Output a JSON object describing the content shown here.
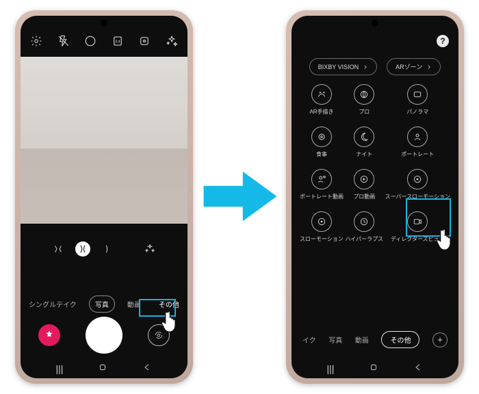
{
  "left": {
    "top_icons": [
      "settings",
      "flash-off",
      "motion-off",
      "aspect-ratio",
      "motion-photo",
      "filters"
    ],
    "modes": {
      "single_take": "シングルテイク",
      "photo": "写真",
      "video": "動画",
      "more": "その他"
    }
  },
  "arrow_color": "#14b9e8",
  "right": {
    "pills": {
      "bixby": "BIXBY VISION",
      "arzone": "ARゾーン"
    },
    "grid": [
      {
        "id": "ar-doodle",
        "label": "AR手描き"
      },
      {
        "id": "pro",
        "label": "プロ"
      },
      {
        "id": "panorama",
        "label": "パノラマ"
      },
      {
        "id": "food",
        "label": "食事"
      },
      {
        "id": "night",
        "label": "ナイト"
      },
      {
        "id": "portrait",
        "label": "ポートレート"
      },
      {
        "id": "portrait-video",
        "label": "ポートレート動画"
      },
      {
        "id": "pro-video",
        "label": "プロ動画"
      },
      {
        "id": "super-slomo",
        "label": "スーパースローモーション"
      },
      {
        "id": "slomo",
        "label": "スローモーション"
      },
      {
        "id": "hyperlapse",
        "label": "ハイパーラプス"
      },
      {
        "id": "directors-view",
        "label": "ディレクターズビュー"
      }
    ],
    "bottom": {
      "leading": "イク",
      "photo": "写真",
      "video": "動画",
      "more": "その他",
      "plus": "+"
    },
    "help": "?"
  }
}
